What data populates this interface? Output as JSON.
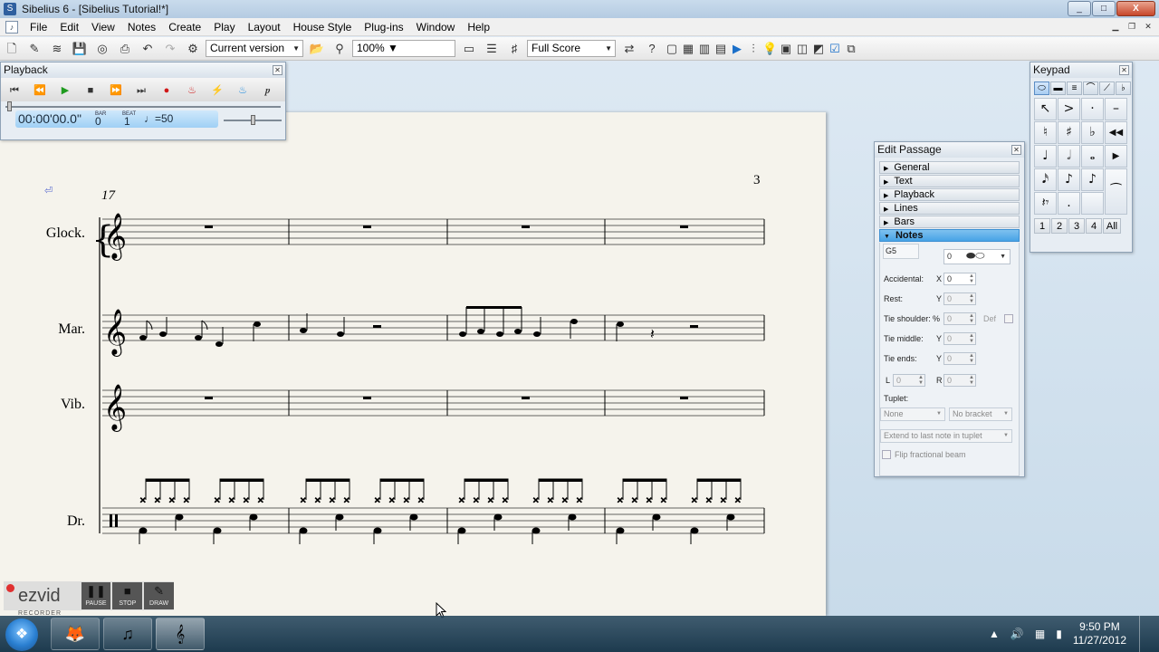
{
  "window": {
    "title": "Sibelius 6 - [Sibelius Tutorial!*]",
    "minimize": "_",
    "maximize": "□",
    "close": "X"
  },
  "menu": {
    "items": [
      "File",
      "Edit",
      "View",
      "Notes",
      "Create",
      "Play",
      "Layout",
      "House Style",
      "Plug-ins",
      "Window",
      "Help"
    ]
  },
  "toolbar": {
    "version_select": "Current version",
    "zoom_value": "100%",
    "view_select": "Full Score"
  },
  "playback": {
    "title": "Playback",
    "clock": "00:00'00.0\"",
    "bar_label": "BAR",
    "bar_value": "0",
    "beat_label": "BEAT",
    "beat_value": "1",
    "tempo": "♩=50"
  },
  "score": {
    "page_number": "3",
    "bar_number": "17",
    "instruments": [
      "Glock.",
      "Mar.",
      "Vib.",
      "Dr."
    ]
  },
  "keypad": {
    "title": "Keypad",
    "tabs": [
      "⬭",
      "▬",
      "≡",
      "⌒",
      "⟋",
      "♭"
    ],
    "keys": [
      "↖",
      ">",
      "·",
      "–",
      "♮",
      "♯",
      "♭",
      "◀◀",
      "♩",
      "𝅗𝅥",
      "𝅝",
      "▶",
      "𝅘𝅥𝅯",
      "♪",
      "♪",
      "⁀",
      "𝄽𝄾",
      ".",
      "",
      ""
    ],
    "layouts": [
      "1",
      "2",
      "3",
      "4",
      "All"
    ]
  },
  "edit_passage": {
    "title": "Edit Passage",
    "sections": [
      "General",
      "Text",
      "Playback",
      "Lines",
      "Bars",
      "Notes"
    ],
    "notehead_label": "G5",
    "notehead_type": "0",
    "accidental_label": "Accidental:",
    "accidental_x": "0",
    "rest_label": "Rest:",
    "rest_y": "0",
    "tie_shoulder_label": "Tie shoulder:",
    "tie_shoulder_value": "0",
    "tie_shoulder_def": "Def",
    "tie_middle_label": "Tie middle:",
    "tie_middle_y": "0",
    "tie_ends_label": "Tie ends:",
    "tie_ends_y": "0",
    "l_label": "L",
    "l_value": "0",
    "r_label": "R",
    "r_value": "0",
    "tuplet_label": "Tuplet:",
    "tuplet_type": "None",
    "tuplet_bracket": "No bracket",
    "tuplet_extend": "Extend to last note in tuplet",
    "flip_beam_label": "Flip fractional beam"
  },
  "ezvid": {
    "logo": "ezvid",
    "subtitle": "RECORDER",
    "pause": "PAUSE",
    "stop": "STOP",
    "draw": "DRAW"
  },
  "taskbar": {
    "time": "9:50 PM",
    "date": "11/27/2012"
  }
}
